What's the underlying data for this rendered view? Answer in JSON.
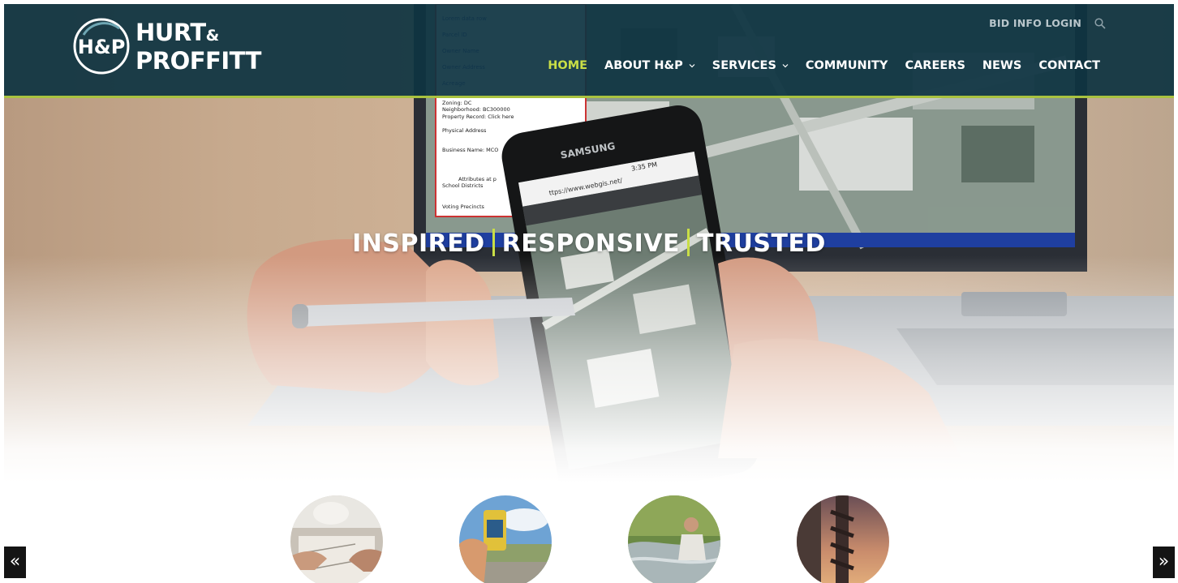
{
  "brand": {
    "logo_monogram": "H&P",
    "name_line1": "HURT",
    "name_amp": "&",
    "name_line2": "PROFFITT",
    "accent_color": "#c9de46",
    "header_color": "#0e3442"
  },
  "header": {
    "bid_info_login": "BID INFO LOGIN",
    "search_icon": "search-icon"
  },
  "nav": {
    "items": [
      {
        "label": "HOME",
        "active": true,
        "has_dropdown": false
      },
      {
        "label": "ABOUT H&P",
        "active": false,
        "has_dropdown": true
      },
      {
        "label": "SERVICES",
        "active": false,
        "has_dropdown": true
      },
      {
        "label": "COMMUNITY",
        "active": false,
        "has_dropdown": false
      },
      {
        "label": "CAREERS",
        "active": false,
        "has_dropdown": false
      },
      {
        "label": "NEWS",
        "active": false,
        "has_dropdown": false
      },
      {
        "label": "CONTACT",
        "active": false,
        "has_dropdown": false
      }
    ]
  },
  "hero": {
    "tagline": [
      "INSPIRED",
      "RESPONSIVE",
      "TRUSTED"
    ],
    "phone_brand": "SAMSUNG",
    "phone_time": "3:35 PM",
    "phone_url": "ttps://www.webgis.net/",
    "panel_text": [
      "Zoning: DC",
      "Neighborhood: BC300000",
      "Property Record: Click here",
      "Physical Address",
      "Business Name: MCO",
      "Attributes at p",
      "School Districts",
      "Voting Precincts"
    ]
  },
  "services": [
    {
      "name": "design-planning",
      "icon": "engineering-plans-photo"
    },
    {
      "name": "surveying",
      "icon": "total-station-photo"
    },
    {
      "name": "environmental",
      "icon": "stream-sampling-photo"
    },
    {
      "name": "geotechnical",
      "icon": "drill-auger-photo"
    }
  ],
  "carousel": {
    "prev_label": "«",
    "next_label": "»"
  }
}
